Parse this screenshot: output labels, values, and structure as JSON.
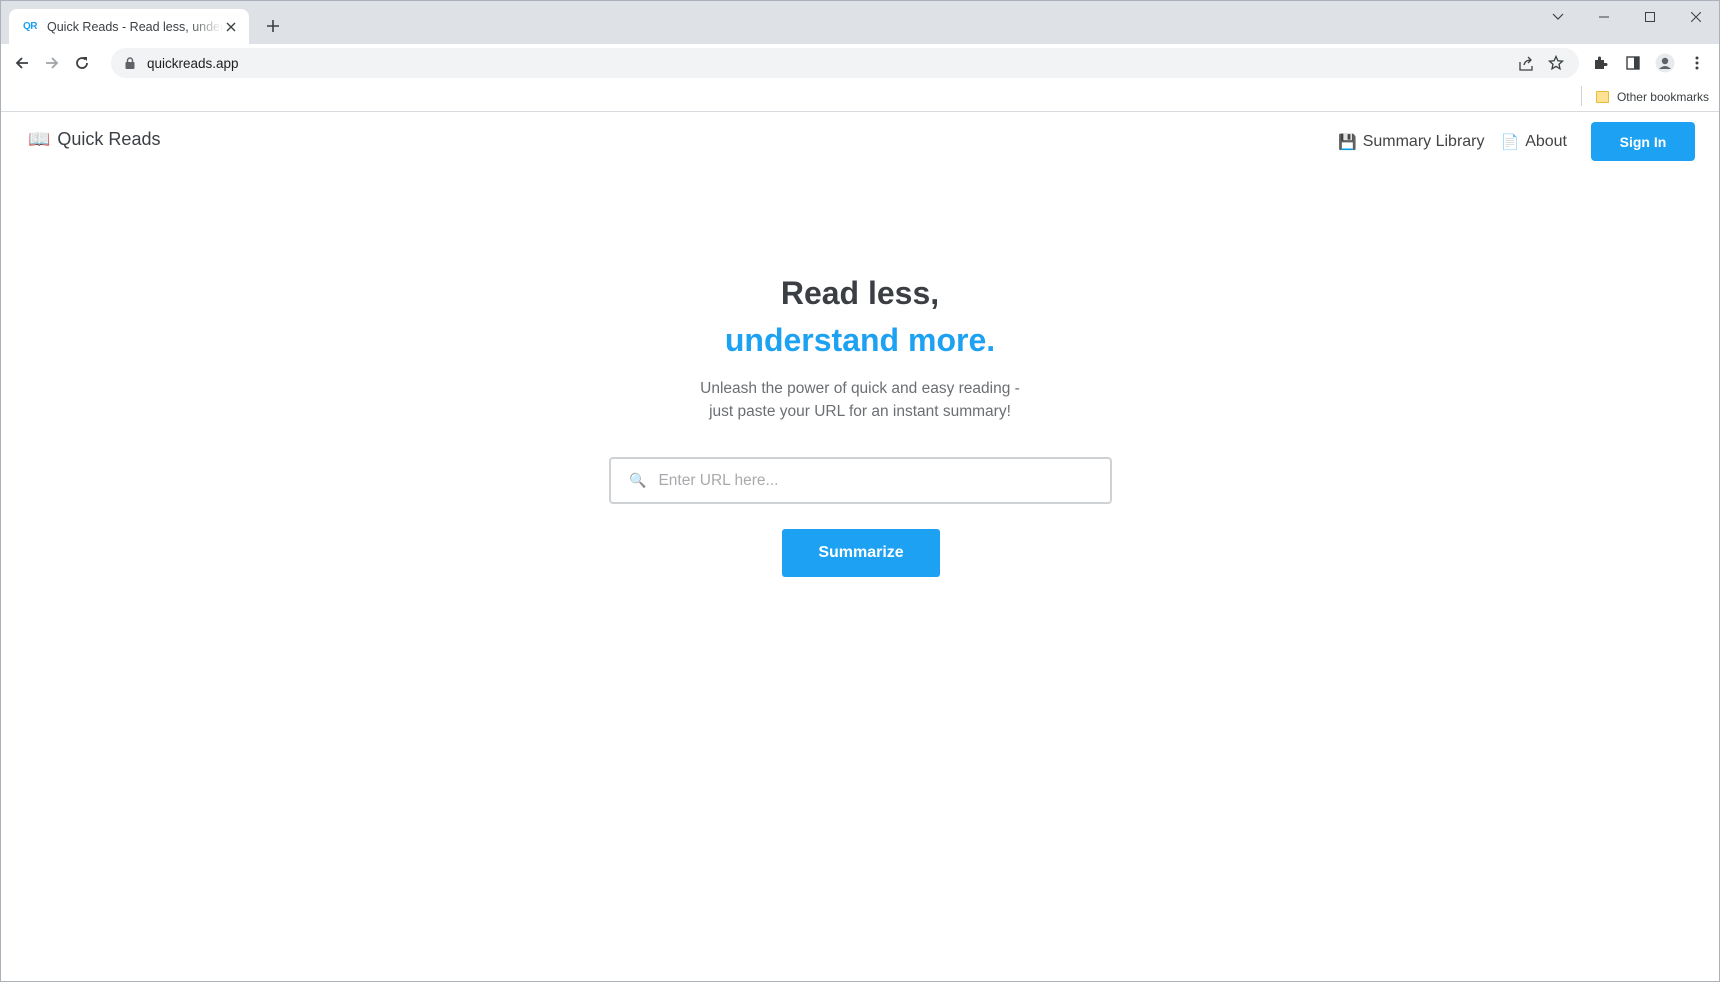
{
  "browser": {
    "tab_favicon": "QR",
    "tab_title": "Quick Reads - Read less, understand more",
    "url": "quickreads.app",
    "bookmarks_other": "Other bookmarks"
  },
  "site": {
    "brand_icon": "📖",
    "brand_name": "Quick Reads",
    "nav": [
      {
        "icon": "💾",
        "label": "Summary Library"
      },
      {
        "icon": "📄",
        "label": "About"
      }
    ],
    "sign_in": "Sign In"
  },
  "hero": {
    "headline_1": "Read less,",
    "headline_2": "understand more.",
    "subtitle_1": "Unleash the power of quick and easy reading -",
    "subtitle_2": "just paste your URL for an instant summary!",
    "search_icon": "🔍",
    "input_placeholder": "Enter URL here...",
    "input_value": "",
    "submit_label": "Summarize"
  },
  "colors": {
    "accent": "#1da1f2",
    "heading": "#3b3f44",
    "muted": "#6b6f73"
  }
}
